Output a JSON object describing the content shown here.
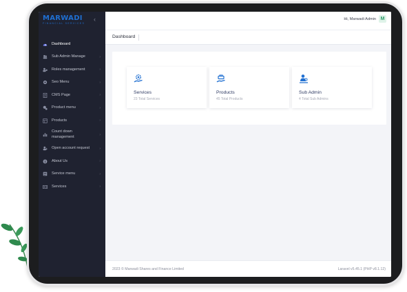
{
  "brand": {
    "name": "MARWADI",
    "tagline": "FINANCIAL SERVICES",
    "color": "#1f6fd1"
  },
  "sidebar": {
    "collapse_icon": "chevron-left-icon",
    "items": [
      {
        "label": "Dashboard",
        "icon": "dashboard-icon",
        "active": true,
        "expandable": false
      },
      {
        "label": "Sub Admin Manage",
        "icon": "users-icon",
        "active": false,
        "expandable": true
      },
      {
        "label": "Roles management",
        "icon": "roles-icon",
        "active": false,
        "expandable": true
      },
      {
        "label": "Seo Menu",
        "icon": "gear-icon",
        "active": false,
        "expandable": true
      },
      {
        "label": "CMS Page",
        "icon": "page-icon",
        "active": false,
        "expandable": true
      },
      {
        "label": "Product menu",
        "icon": "product-menu-icon",
        "active": false,
        "expandable": true
      },
      {
        "label": "Products",
        "icon": "products-icon",
        "active": false,
        "expandable": true
      },
      {
        "label": "Count down management",
        "icon": "chart-icon",
        "active": false,
        "expandable": true
      },
      {
        "label": "Open account request",
        "icon": "account-icon",
        "active": false,
        "expandable": true
      },
      {
        "label": "About Us",
        "icon": "info-icon",
        "active": false,
        "expandable": true
      },
      {
        "label": "Service menu",
        "icon": "list-icon",
        "active": false,
        "expandable": true
      },
      {
        "label": "Services",
        "icon": "services-icon",
        "active": false,
        "expandable": true
      }
    ]
  },
  "header": {
    "greeting": "Hi, Marwadi Admin",
    "avatar_letter": "M",
    "avatar_color": "#2e9d6a"
  },
  "page": {
    "title": "Dashboard"
  },
  "cards": [
    {
      "title": "Services",
      "subtitle": "23 Total Services",
      "icon": "services-gear-hand-icon"
    },
    {
      "title": "Products",
      "subtitle": "45 Total Products",
      "icon": "products-hand-icon"
    },
    {
      "title": "Sub Admin",
      "subtitle": "4 Total Sub Admins",
      "icon": "sub-admin-icon"
    }
  ],
  "footer": {
    "copyright": "2023 © Marwadi Shares and Finance Limited",
    "version": "Laravel v5.45.1 (PHP v8.1.12)"
  },
  "colors": {
    "sidebar_bg": "#1f2230",
    "accent": "#1f6fd1",
    "card_title": "#2f3b63"
  }
}
